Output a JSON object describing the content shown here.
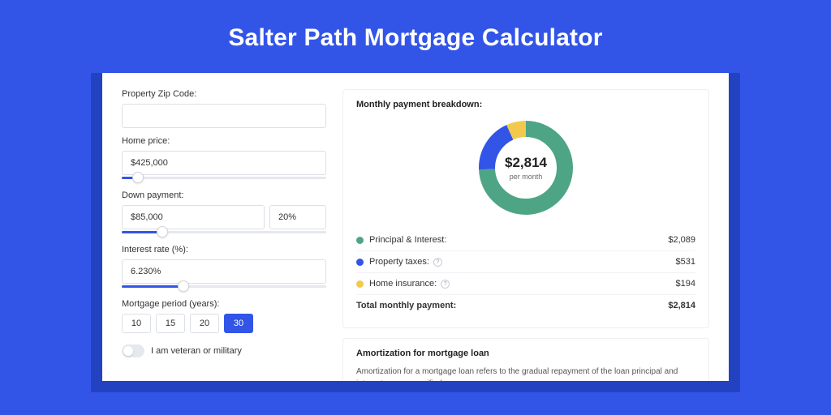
{
  "page_title": "Salter Path Mortgage Calculator",
  "form": {
    "zip": {
      "label": "Property Zip Code:",
      "value": ""
    },
    "home_price": {
      "label": "Home price:",
      "value": "$425,000",
      "slider_pct": 8
    },
    "down_payment": {
      "label": "Down payment:",
      "value": "$85,000",
      "pct": "20%",
      "slider_pct": 20
    },
    "interest_rate": {
      "label": "Interest rate (%):",
      "value": "6.230%",
      "slider_pct": 30
    },
    "period": {
      "label": "Mortgage period (years):",
      "options": [
        "10",
        "15",
        "20",
        "30"
      ],
      "selected": "30"
    },
    "veteran": {
      "label": "I am veteran or military",
      "checked": false
    }
  },
  "breakdown": {
    "title": "Monthly payment breakdown:",
    "center_value": "$2,814",
    "center_sub": "per month",
    "items": [
      {
        "label": "Principal & Interest:",
        "amount": "$2,089",
        "color": "g",
        "info": false
      },
      {
        "label": "Property taxes:",
        "amount": "$531",
        "color": "b",
        "info": true
      },
      {
        "label": "Home insurance:",
        "amount": "$194",
        "color": "y",
        "info": true
      }
    ],
    "total": {
      "label": "Total monthly payment:",
      "amount": "$2,814"
    }
  },
  "amortization": {
    "title": "Amortization for mortgage loan",
    "text": "Amortization for a mortgage loan refers to the gradual repayment of the loan principal and interest over a specified"
  },
  "colors": {
    "g": "#4ea585",
    "b": "#3255e8",
    "y": "#f2c94c"
  },
  "chart_data": {
    "type": "pie",
    "title": "Monthly payment breakdown",
    "series": [
      {
        "name": "Principal & Interest",
        "value": 2089,
        "color": "#4ea585"
      },
      {
        "name": "Property taxes",
        "value": 531,
        "color": "#3255e8"
      },
      {
        "name": "Home insurance",
        "value": 194,
        "color": "#f2c94c"
      }
    ],
    "total": 2814,
    "center_label": "$2,814 per month"
  }
}
